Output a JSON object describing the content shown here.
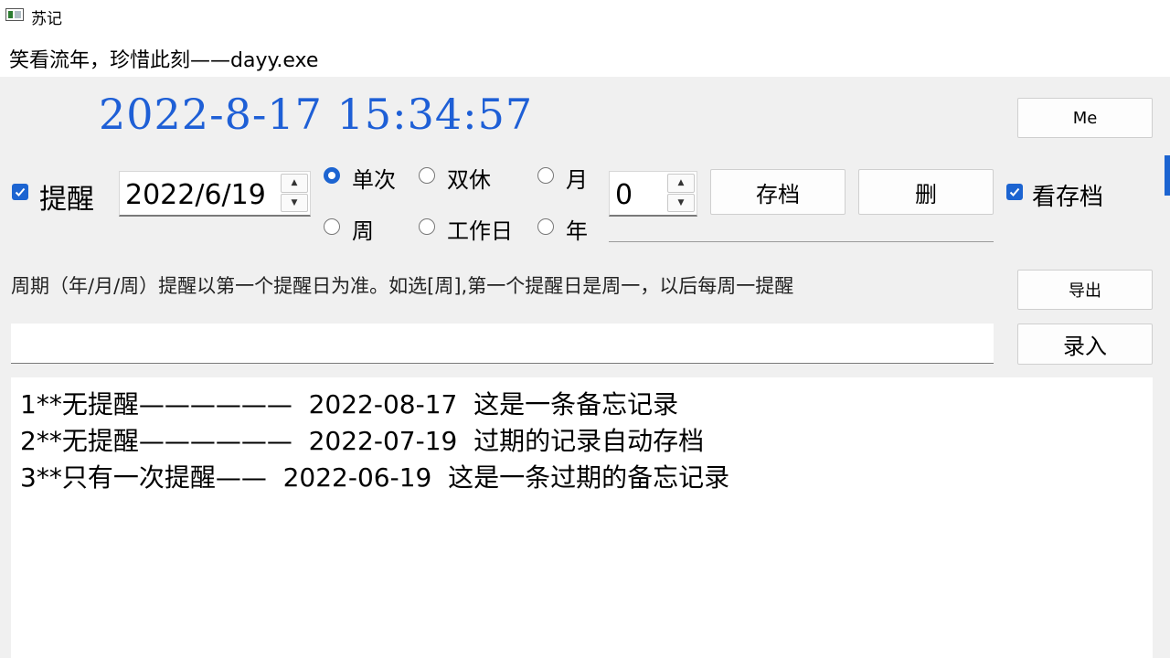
{
  "window": {
    "title": "苏记"
  },
  "menu": {
    "label": "笑看流年，珍惜此刻——dayy.exe"
  },
  "clock": {
    "datetime": "2022-8-17 15:34:57"
  },
  "buttons": {
    "me": "Me",
    "save": "存档",
    "delete": "删",
    "export": "导出",
    "enter": "录入"
  },
  "reminder": {
    "checkbox_label": "提醒",
    "checked": true,
    "date_value": "2022/6/19"
  },
  "repeat_options": [
    {
      "label": "单次",
      "selected": true
    },
    {
      "label": "双休",
      "selected": false
    },
    {
      "label": "月",
      "selected": false
    },
    {
      "label": "周",
      "selected": false
    },
    {
      "label": "工作日",
      "selected": false
    },
    {
      "label": "年",
      "selected": false
    }
  ],
  "count": {
    "value": "0"
  },
  "view_archive": {
    "label": "看存档",
    "checked": true
  },
  "hint": "周期（年/月/周）提醒以第一个提醒日为准。如选[周],第一个提醒日是周一，以后每周一提醒",
  "entry": {
    "value": ""
  },
  "records": [
    "1**无提醒——————  2022-08-17  这是一条备忘记录",
    "2**无提醒——————  2022-07-19  过期的记录自动存档",
    "3**只有一次提醒——  2022-06-19  这是一条过期的备忘记录"
  ],
  "colors": {
    "accent": "#1c64d1",
    "clock": "#1e5fd6",
    "panel": "#f0f0f0"
  }
}
